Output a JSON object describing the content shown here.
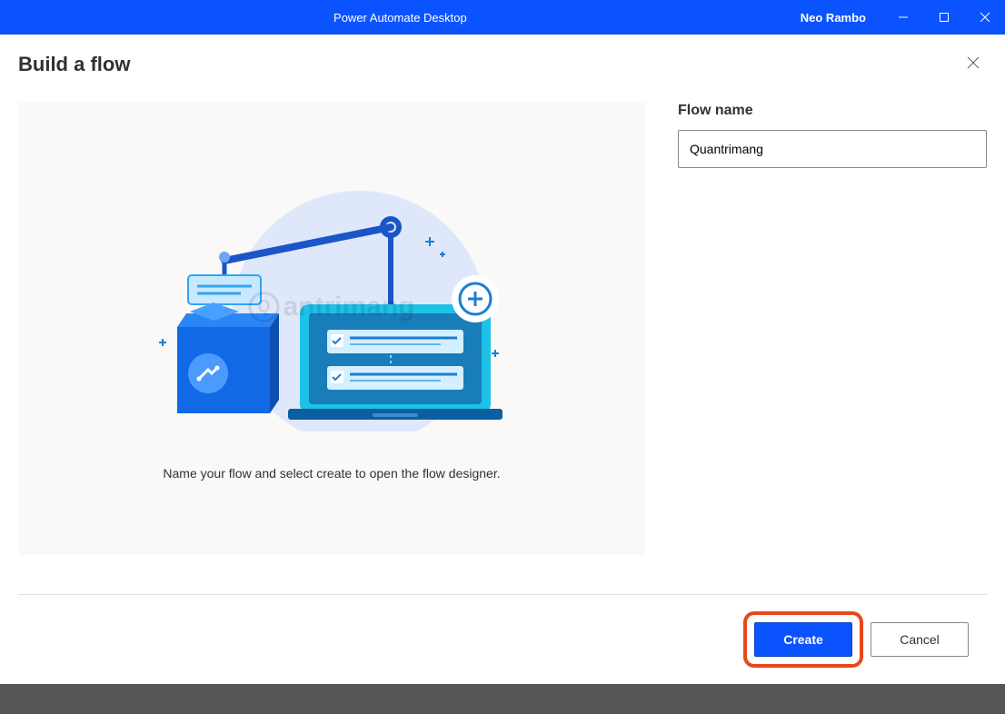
{
  "titlebar": {
    "title": "Power Automate Desktop",
    "user": "Neo Rambo"
  },
  "page": {
    "title": "Build a flow"
  },
  "illustration": {
    "caption": "Name your flow and select create to open the flow designer.",
    "watermark": "antrimang"
  },
  "form": {
    "flow_name_label": "Flow name",
    "flow_name_value": "Quantrimang"
  },
  "footer": {
    "create_label": "Create",
    "cancel_label": "Cancel"
  }
}
